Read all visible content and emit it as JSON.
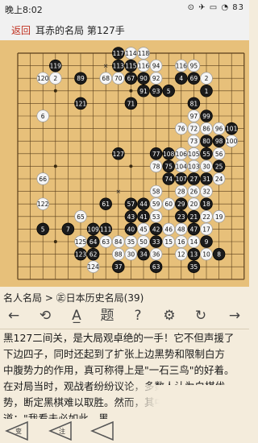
{
  "status": {
    "time": "晚上8:02",
    "indicators": "⊙ ✈ ▭ ◔ 83"
  },
  "header": {
    "back_label": "返回",
    "title": "耳赤的名局 第127手"
  },
  "board": {
    "size": 19,
    "stones": [
      {
        "c": "b",
        "col": 8,
        "row": 0,
        "n": "117"
      },
      {
        "c": "w",
        "col": 9,
        "row": 0,
        "n": "114"
      },
      {
        "c": "w",
        "col": 10,
        "row": 0,
        "n": "118"
      },
      {
        "c": "b",
        "col": 8,
        "row": 1,
        "n": "113"
      },
      {
        "c": "b",
        "col": 9,
        "row": 1,
        "n": "115"
      },
      {
        "c": "w",
        "col": 10,
        "row": 1,
        "n": "116"
      },
      {
        "c": "b",
        "col": 3,
        "row": 1,
        "n": "119"
      },
      {
        "c": "w",
        "col": 11,
        "row": 1,
        "n": "94"
      },
      {
        "c": "w",
        "col": 13,
        "row": 1,
        "n": "116"
      },
      {
        "c": "w",
        "col": 14,
        "row": 1,
        "n": "95"
      },
      {
        "c": "w",
        "col": 2,
        "row": 2,
        "n": "120"
      },
      {
        "c": "w",
        "col": 3,
        "row": 2,
        "n": "2"
      },
      {
        "c": "b",
        "col": 5,
        "row": 2,
        "n": "89"
      },
      {
        "c": "w",
        "col": 7,
        "row": 2,
        "n": "68"
      },
      {
        "c": "w",
        "col": 8,
        "row": 2,
        "n": "70"
      },
      {
        "c": "b",
        "col": 9,
        "row": 2,
        "n": "67"
      },
      {
        "c": "b",
        "col": 10,
        "row": 2,
        "n": "90"
      },
      {
        "c": "w",
        "col": 11,
        "row": 2,
        "n": "92"
      },
      {
        "c": "b",
        "col": 13,
        "row": 2,
        "n": "4"
      },
      {
        "c": "b",
        "col": 14,
        "row": 2,
        "n": "69"
      },
      {
        "c": "w",
        "col": 15,
        "row": 2,
        "n": "2"
      },
      {
        "c": "b",
        "col": 10,
        "row": 3,
        "n": "91"
      },
      {
        "c": "b",
        "col": 11,
        "row": 3,
        "n": "93"
      },
      {
        "c": "b",
        "col": 12,
        "row": 3,
        "n": "5"
      },
      {
        "c": "b",
        "col": 15,
        "row": 3,
        "n": "1"
      },
      {
        "c": "b",
        "col": 5,
        "row": 4,
        "n": "121"
      },
      {
        "c": "b",
        "col": 9,
        "row": 4,
        "n": "71"
      },
      {
        "c": "b",
        "col": 14,
        "row": 4,
        "n": "81"
      },
      {
        "c": "w",
        "col": 2,
        "row": 5,
        "n": "6"
      },
      {
        "c": "w",
        "col": 14,
        "row": 5,
        "n": "97"
      },
      {
        "c": "b",
        "col": 15,
        "row": 5,
        "n": "99"
      },
      {
        "c": "w",
        "col": 13,
        "row": 6,
        "n": "76"
      },
      {
        "c": "w",
        "col": 14,
        "row": 6,
        "n": "72"
      },
      {
        "c": "w",
        "col": 15,
        "row": 6,
        "n": "86"
      },
      {
        "c": "w",
        "col": 16,
        "row": 6,
        "n": "96"
      },
      {
        "c": "b",
        "col": 17,
        "row": 6,
        "n": "101"
      },
      {
        "c": "w",
        "col": 14,
        "row": 7,
        "n": "73"
      },
      {
        "c": "b",
        "col": 15,
        "row": 7,
        "n": "80"
      },
      {
        "c": "b",
        "col": 16,
        "row": 7,
        "n": "98"
      },
      {
        "c": "w",
        "col": 17,
        "row": 7,
        "n": "100"
      },
      {
        "c": "b",
        "col": 8,
        "row": 8,
        "n": "127"
      },
      {
        "c": "b",
        "col": 11,
        "row": 8,
        "n": "77"
      },
      {
        "c": "b",
        "col": 12,
        "row": 8,
        "n": "108"
      },
      {
        "c": "w",
        "col": 13,
        "row": 8,
        "n": "106"
      },
      {
        "c": "w",
        "col": 14,
        "row": 8,
        "n": "105"
      },
      {
        "c": "b",
        "col": 15,
        "row": 8,
        "n": "55"
      },
      {
        "c": "w",
        "col": 16,
        "row": 8,
        "n": "56"
      },
      {
        "c": "w",
        "col": 11,
        "row": 9,
        "n": "78"
      },
      {
        "c": "b",
        "col": 12,
        "row": 9,
        "n": "75"
      },
      {
        "c": "w",
        "col": 13,
        "row": 9,
        "n": "104"
      },
      {
        "c": "w",
        "col": 14,
        "row": 9,
        "n": "103"
      },
      {
        "c": "w",
        "col": 15,
        "row": 9,
        "n": "30"
      },
      {
        "c": "b",
        "col": 16,
        "row": 9,
        "n": "25"
      },
      {
        "c": "w",
        "col": 2,
        "row": 10,
        "n": "66"
      },
      {
        "c": "b",
        "col": 12,
        "row": 10,
        "n": "74"
      },
      {
        "c": "b",
        "col": 13,
        "row": 10,
        "n": "107"
      },
      {
        "c": "b",
        "col": 14,
        "row": 10,
        "n": "27"
      },
      {
        "c": "b",
        "col": 15,
        "row": 10,
        "n": "31"
      },
      {
        "c": "w",
        "col": 16,
        "row": 10,
        "n": "24"
      },
      {
        "c": "w",
        "col": 11,
        "row": 11,
        "n": "58"
      },
      {
        "c": "w",
        "col": 13,
        "row": 11,
        "n": "28"
      },
      {
        "c": "w",
        "col": 14,
        "row": 11,
        "n": "26"
      },
      {
        "c": "w",
        "col": 15,
        "row": 11,
        "n": "32"
      },
      {
        "c": "w",
        "col": 2,
        "row": 12,
        "n": "122"
      },
      {
        "c": "b",
        "col": 7,
        "row": 12,
        "n": "61"
      },
      {
        "c": "b",
        "col": 9,
        "row": 12,
        "n": "57"
      },
      {
        "c": "b",
        "col": 10,
        "row": 12,
        "n": "44"
      },
      {
        "c": "w",
        "col": 11,
        "row": 12,
        "n": "59"
      },
      {
        "c": "w",
        "col": 12,
        "row": 12,
        "n": "60"
      },
      {
        "c": "b",
        "col": 13,
        "row": 12,
        "n": "29"
      },
      {
        "c": "w",
        "col": 14,
        "row": 12,
        "n": "20"
      },
      {
        "c": "b",
        "col": 15,
        "row": 12,
        "n": "18"
      },
      {
        "c": "w",
        "col": 5,
        "row": 13,
        "n": "65"
      },
      {
        "c": "b",
        "col": 9,
        "row": 13,
        "n": "43"
      },
      {
        "c": "b",
        "col": 10,
        "row": 13,
        "n": "41"
      },
      {
        "c": "w",
        "col": 11,
        "row": 13,
        "n": "53"
      },
      {
        "c": "b",
        "col": 13,
        "row": 13,
        "n": "23"
      },
      {
        "c": "b",
        "col": 14,
        "row": 13,
        "n": "21"
      },
      {
        "c": "w",
        "col": 15,
        "row": 13,
        "n": "22"
      },
      {
        "c": "w",
        "col": 16,
        "row": 13,
        "n": "19"
      },
      {
        "c": "b",
        "col": 2,
        "row": 14,
        "n": "5"
      },
      {
        "c": "b",
        "col": 4,
        "row": 14,
        "n": "7"
      },
      {
        "c": "b",
        "col": 6,
        "row": 14,
        "n": "109"
      },
      {
        "c": "b",
        "col": 7,
        "row": 14,
        "n": "111"
      },
      {
        "c": "b",
        "col": 9,
        "row": 14,
        "n": "40"
      },
      {
        "c": "w",
        "col": 10,
        "row": 14,
        "n": "45"
      },
      {
        "c": "b",
        "col": 11,
        "row": 14,
        "n": "42"
      },
      {
        "c": "w",
        "col": 12,
        "row": 14,
        "n": "46"
      },
      {
        "c": "w",
        "col": 13,
        "row": 14,
        "n": "48"
      },
      {
        "c": "b",
        "col": 14,
        "row": 14,
        "n": "47"
      },
      {
        "c": "w",
        "col": 15,
        "row": 14,
        "n": "17"
      },
      {
        "c": "w",
        "col": 5,
        "row": 15,
        "n": "125"
      },
      {
        "c": "b",
        "col": 6,
        "row": 15,
        "n": "64"
      },
      {
        "c": "w",
        "col": 7,
        "row": 15,
        "n": "63"
      },
      {
        "c": "w",
        "col": 8,
        "row": 15,
        "n": "84"
      },
      {
        "c": "w",
        "col": 9,
        "row": 15,
        "n": "35"
      },
      {
        "c": "w",
        "col": 10,
        "row": 15,
        "n": "50"
      },
      {
        "c": "b",
        "col": 11,
        "row": 15,
        "n": "33"
      },
      {
        "c": "w",
        "col": 12,
        "row": 15,
        "n": "15"
      },
      {
        "c": "w",
        "col": 13,
        "row": 15,
        "n": "16"
      },
      {
        "c": "w",
        "col": 14,
        "row": 15,
        "n": "14"
      },
      {
        "c": "b",
        "col": 15,
        "row": 15,
        "n": "9"
      },
      {
        "c": "b",
        "col": 5,
        "row": 16,
        "n": "123"
      },
      {
        "c": "b",
        "col": 6,
        "row": 16,
        "n": "62"
      },
      {
        "c": "w",
        "col": 8,
        "row": 16,
        "n": "88"
      },
      {
        "c": "w",
        "col": 9,
        "row": 16,
        "n": "30"
      },
      {
        "c": "b",
        "col": 10,
        "row": 16,
        "n": "34"
      },
      {
        "c": "w",
        "col": 11,
        "row": 16,
        "n": "36"
      },
      {
        "c": "w",
        "col": 13,
        "row": 16,
        "n": "12"
      },
      {
        "c": "b",
        "col": 14,
        "row": 16,
        "n": "13"
      },
      {
        "c": "w",
        "col": 15,
        "row": 16,
        "n": "10"
      },
      {
        "c": "b",
        "col": 16,
        "row": 16,
        "n": "8"
      },
      {
        "c": "w",
        "col": 6,
        "row": 17,
        "n": "124"
      },
      {
        "c": "b",
        "col": 8,
        "row": 17,
        "n": "37"
      },
      {
        "c": "b",
        "col": 11,
        "row": 17,
        "n": "63"
      },
      {
        "c": "b",
        "col": 14,
        "row": 17,
        "n": "35"
      }
    ],
    "marks": [
      {
        "col": 7,
        "row": 1,
        "sym": "✕"
      },
      {
        "col": 11,
        "row": 3,
        "sym": "✕"
      },
      {
        "col": 8,
        "row": 11,
        "sym": "✕"
      }
    ]
  },
  "breadcrumb": "名人名局 > ㊣日本历史名局(39)",
  "toolbar": {
    "items": [
      {
        "name": "prev-arrow-icon",
        "glyph": "←"
      },
      {
        "name": "undo-icon",
        "glyph": "⟲"
      },
      {
        "name": "font-size-icon",
        "glyph": "A̲"
      },
      {
        "name": "problem-icon",
        "glyph": "题"
      },
      {
        "name": "help-icon",
        "glyph": "?"
      },
      {
        "name": "settings-icon",
        "glyph": "⚙"
      },
      {
        "name": "rotate-icon",
        "glyph": "↻"
      },
      {
        "name": "next-arrow-icon",
        "glyph": "→"
      }
    ]
  },
  "commentary": [
    "黑127二间关，是大局观卓绝的一手！它不但声援了",
    "下边四子，同时还起到了扩张上边黑势和限制白方",
    "中腹势力的作用，真可称得上是\"一石三鸟\"的好着。",
    "在对局当时，观战者纷纷议论，多数人认为白棋优",
    "势，断定黑棋难以取胜。然而，其中有一位医生却",
    "道：\"我看未必如此，黑......"
  ],
  "bottombar": {
    "left_label": "变",
    "mid_label": "注"
  }
}
